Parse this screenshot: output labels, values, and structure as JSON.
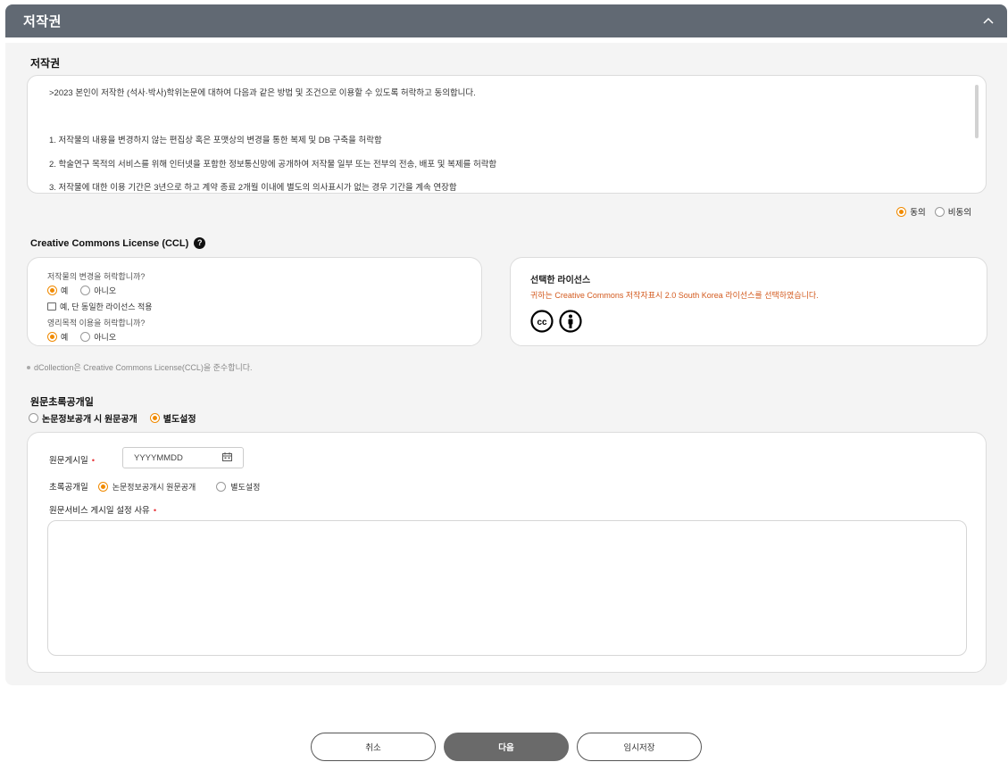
{
  "header": {
    "title": "저작권"
  },
  "copyright": {
    "section_title": "저작권",
    "lines": [
      ">2023 본인이 저작한 (석사·박사)학위논문에 대하여 다음과 같은 방법 및 조건으로 이용할 수 있도록 허락하고 동의합니다.",
      "1. 저작물의 내용을 변경하지 않는 편집상 혹은 포맷상의 변경을 통한 복제 및 DB 구축을 허락함",
      "2. 학술연구 목적의 서비스를 위해 인터넷을 포함한 정보통신망에 공개하여 저작물 일부 또는 전부의 전송, 배포 및 복제를 허락함",
      "3. 저작물에 대한 이용 기간은 3년으로 하고 계약 종료 2개월 이내에 별도의 의사표시가 없는 경우 기간을 계속 연장함"
    ],
    "agree_label": "동의",
    "disagree_label": "비동의",
    "agree_selected": true
  },
  "ccl": {
    "title": "Creative Commons License (CCL)",
    "q1": "저작물의 변경을 허락합니까?",
    "q1_yes": "예",
    "q1_no": "아니오",
    "q1_sub": "예, 단 동일한 라이선스 적용",
    "q2": "영리목적 이용을 허락합니까?",
    "q2_yes": "예",
    "q2_no": "아니오",
    "selected_title": "선택한 라이선스",
    "selected_desc": "귀하는 Creative Commons 저작자표시 2.0 South Korea 라이선스를 선택하였습니다.",
    "note": "dCollection은 Creative Commons License(CCL)을 준수합니다.",
    "icons": [
      "cc-icon",
      "attribution-icon"
    ]
  },
  "original": {
    "title": "원문초록공개일",
    "opt_public": "논문정보공개 시 원문공개",
    "opt_custom": "별도설정",
    "custom_selected": true,
    "post_date_label": "원문게시일",
    "date_placeholder": "YYYYMMDD",
    "abstract_label": "초록공개일",
    "abstract_opt1": "논문정보공개시 원문공개",
    "abstract_opt2": "별도설정",
    "reason_label": "원문서비스 게시일 설정 사유"
  },
  "buttons": {
    "cancel": "취소",
    "next": "다음",
    "save_temp": "임시저장"
  },
  "colors": {
    "accent": "#f08a00",
    "header": "#616973",
    "required": "#e8383d",
    "license_text": "#d35a1e"
  }
}
